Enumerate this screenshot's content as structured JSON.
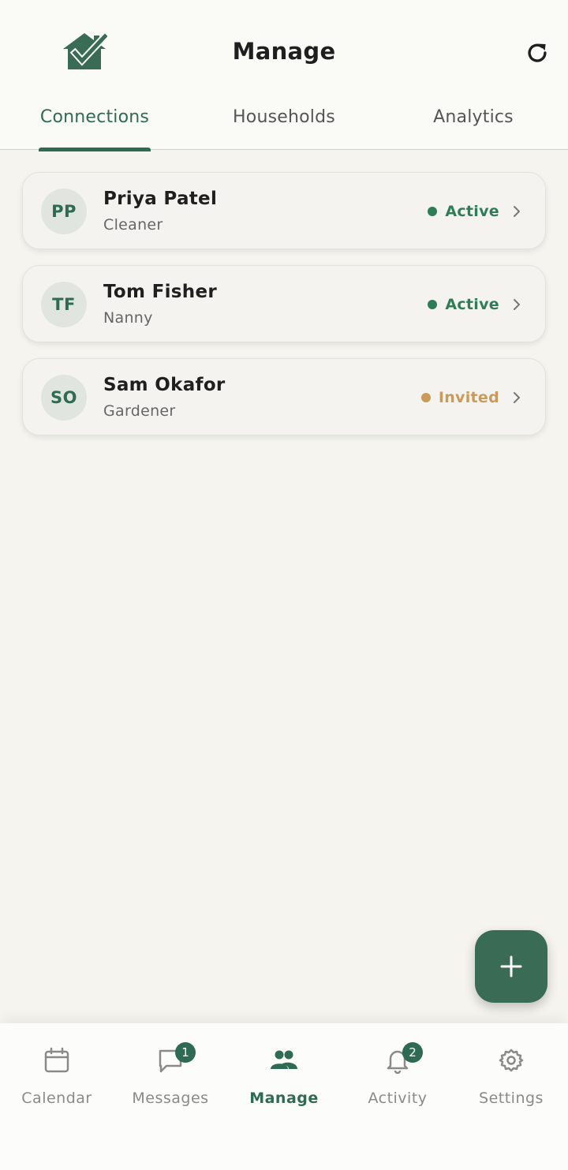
{
  "header": {
    "title": "Manage",
    "logo_icon": "house-check-icon",
    "refresh_icon": "refresh-icon"
  },
  "tabs": [
    {
      "label": "Connections",
      "active": true
    },
    {
      "label": "Households",
      "active": false
    },
    {
      "label": "Analytics",
      "active": false
    }
  ],
  "connections": [
    {
      "initials": "PP",
      "name": "Priya Patel",
      "role": "Cleaner",
      "status": "Active",
      "status_color": "#2f7d57"
    },
    {
      "initials": "TF",
      "name": "Tom Fisher",
      "role": "Nanny",
      "status": "Active",
      "status_color": "#2f7d57"
    },
    {
      "initials": "SO",
      "name": "Sam Okafor",
      "role": "Gardener",
      "status": "Invited",
      "status_color": "#c99a5b"
    }
  ],
  "fab": {
    "icon": "plus-icon"
  },
  "bottom_nav": [
    {
      "label": "Calendar",
      "icon": "calendar-icon",
      "badge": null,
      "active": false
    },
    {
      "label": "Messages",
      "icon": "chat-bubble-icon",
      "badge": "1",
      "active": false
    },
    {
      "label": "Manage",
      "icon": "people-icon",
      "badge": null,
      "active": true
    },
    {
      "label": "Activity",
      "icon": "bell-icon",
      "badge": "2",
      "active": false
    },
    {
      "label": "Settings",
      "icon": "gear-icon",
      "badge": null,
      "active": false
    }
  ],
  "colors": {
    "brand": "#2f6b52",
    "background": "#f5f4ef",
    "active_status": "#2f7d57",
    "invited_status": "#c99a5b"
  }
}
